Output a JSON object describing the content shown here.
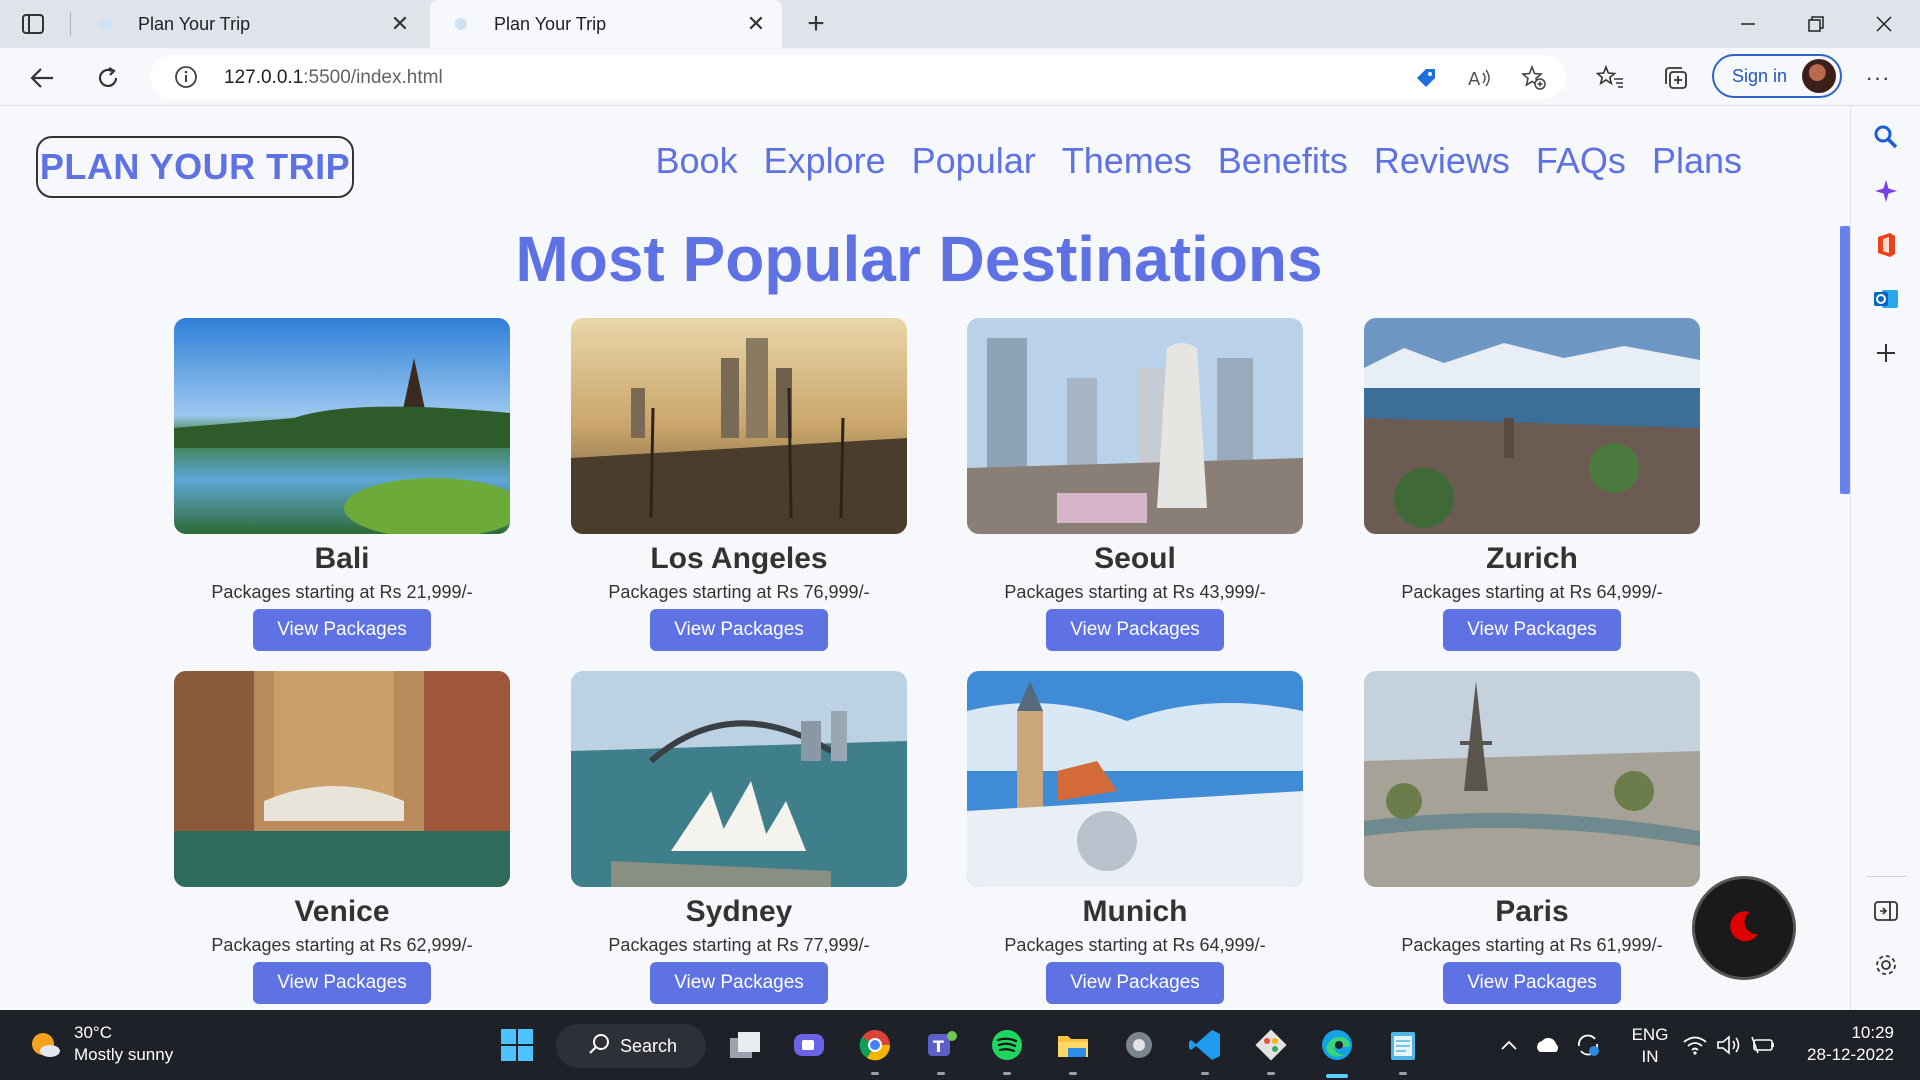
{
  "browser": {
    "tabs": [
      {
        "title": "Plan Your Trip",
        "active": false
      },
      {
        "title": "Plan Your Trip",
        "active": true
      }
    ],
    "url_host": "127.0.0.1",
    "url_rest": ":5500/index.html",
    "signin_label": "Sign in"
  },
  "site": {
    "logo": "PLAN YOUR TRIP",
    "nav": [
      "Book",
      "Explore",
      "Popular",
      "Themes",
      "Benefits",
      "Reviews",
      "FAQs",
      "Plans"
    ],
    "heading": "Most Popular Destinations",
    "button_label": "View Packages",
    "destinations": [
      {
        "name": "Bali",
        "price": "Packages starting at Rs 21,999/-"
      },
      {
        "name": "Los Angeles",
        "price": "Packages starting at Rs 76,999/-"
      },
      {
        "name": "Seoul",
        "price": "Packages starting at Rs 43,999/-"
      },
      {
        "name": "Zurich",
        "price": "Packages starting at Rs 64,999/-"
      },
      {
        "name": "Venice",
        "price": "Packages starting at Rs 62,999/-"
      },
      {
        "name": "Sydney",
        "price": "Packages starting at Rs 77,999/-"
      },
      {
        "name": "Munich",
        "price": "Packages starting at Rs 64,999/-"
      },
      {
        "name": "Paris",
        "price": "Packages starting at Rs 61,999/-"
      }
    ]
  },
  "taskbar": {
    "weather_temp": "30°C",
    "weather_desc": "Mostly sunny",
    "search_label": "Search",
    "lang_top": "ENG",
    "lang_bottom": "IN",
    "time": "10:29",
    "date": "28-12-2022"
  },
  "colors": {
    "accent": "#5e72e4",
    "page_bg": "#f7f8fc",
    "taskbar_bg": "#1f2128"
  }
}
